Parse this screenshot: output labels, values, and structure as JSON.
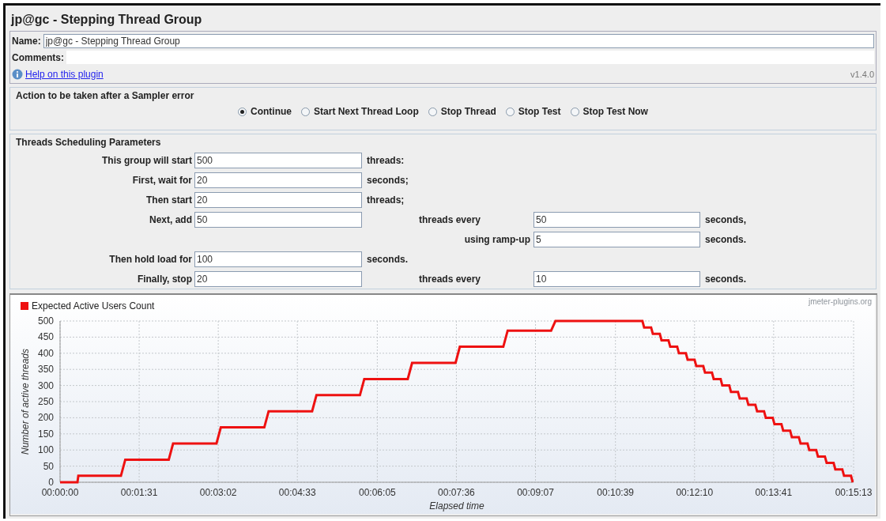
{
  "window": {
    "title": "jp@gc - Stepping Thread Group"
  },
  "name_field": {
    "label": "Name:",
    "value": "jp@gc - Stepping Thread Group"
  },
  "comments_field": {
    "label": "Comments:"
  },
  "help_link": "Help on this plugin",
  "version": "v1.4.0",
  "sampler_error": {
    "title": "Action to be taken after a Sampler error",
    "options": [
      {
        "label": "Continue",
        "selected": true
      },
      {
        "label": "Start Next Thread Loop",
        "selected": false
      },
      {
        "label": "Stop Thread",
        "selected": false
      },
      {
        "label": "Stop Test",
        "selected": false
      },
      {
        "label": "Stop Test Now",
        "selected": false
      }
    ]
  },
  "scheduling": {
    "title": "Threads Scheduling Parameters",
    "rows": [
      {
        "kind": "single",
        "label": "This group will start",
        "value": "500",
        "unit": "threads:"
      },
      {
        "kind": "single",
        "label": "First, wait for",
        "value": "20",
        "unit": "seconds;"
      },
      {
        "kind": "single",
        "label": "Then start",
        "value": "20",
        "unit": "threads;"
      },
      {
        "kind": "double",
        "label": "Next, add",
        "value": "50",
        "label_2": "threads every",
        "value_2": "50",
        "unit_2": "seconds,"
      },
      {
        "kind": "ramp",
        "label_2": "using ramp-up",
        "value_2": "5",
        "unit_2": "seconds."
      },
      {
        "kind": "single",
        "label": "Then hold load for",
        "value": "100",
        "unit": "seconds."
      },
      {
        "kind": "double",
        "label": "Finally, stop",
        "value": "20",
        "label_2": "threads every",
        "value_2": "10",
        "unit_2": "seconds."
      }
    ]
  },
  "chart": {
    "site_mark": "jmeter-plugins.org",
    "chart_data": {
      "type": "line",
      "xlabel": "Elapsed time",
      "ylabel": "Number of active threads",
      "x": [
        0,
        20,
        21,
        70,
        75,
        125,
        130,
        180,
        185,
        235,
        240,
        290,
        295,
        345,
        350,
        400,
        405,
        455,
        460,
        510,
        515,
        565,
        570,
        670,
        672,
        680,
        682,
        690,
        692,
        700,
        702,
        710,
        712,
        720,
        722,
        730,
        732,
        740,
        742,
        750,
        752,
        760,
        762,
        770,
        772,
        780,
        782,
        790,
        792,
        800,
        802,
        810,
        812,
        820,
        822,
        830,
        832,
        840,
        842,
        850,
        852,
        860,
        862,
        870,
        872,
        880,
        882,
        890,
        892,
        900,
        902,
        910,
        912
      ],
      "series": [
        {
          "name": "Expected Active Users Count",
          "color": "#ee1111",
          "values": [
            0,
            0,
            20,
            20,
            70,
            70,
            120,
            120,
            170,
            170,
            220,
            220,
            270,
            270,
            320,
            320,
            370,
            370,
            420,
            420,
            470,
            470,
            500,
            500,
            480,
            480,
            460,
            460,
            440,
            440,
            420,
            420,
            400,
            400,
            380,
            380,
            360,
            360,
            340,
            340,
            320,
            320,
            300,
            300,
            280,
            280,
            260,
            260,
            240,
            240,
            220,
            220,
            200,
            200,
            180,
            180,
            160,
            160,
            140,
            140,
            120,
            120,
            100,
            100,
            80,
            80,
            60,
            60,
            40,
            40,
            20,
            20,
            0
          ]
        }
      ],
      "xlim": [
        0,
        913
      ],
      "ylim": [
        0,
        500
      ],
      "xticks": [
        {
          "value": 0,
          "label": "00:00:00"
        },
        {
          "value": 91,
          "label": "00:01:31"
        },
        {
          "value": 182,
          "label": "00:03:02"
        },
        {
          "value": 273,
          "label": "00:04:33"
        },
        {
          "value": 365,
          "label": "00:06:05"
        },
        {
          "value": 456,
          "label": "00:07:36"
        },
        {
          "value": 547,
          "label": "00:09:07"
        },
        {
          "value": 639,
          "label": "00:10:39"
        },
        {
          "value": 730,
          "label": "00:12:10"
        },
        {
          "value": 821,
          "label": "00:13:41"
        },
        {
          "value": 913,
          "label": "00:15:13"
        }
      ],
      "yticks": [
        0,
        50,
        100,
        150,
        200,
        250,
        300,
        350,
        400,
        450,
        500
      ],
      "grid": true
    }
  }
}
